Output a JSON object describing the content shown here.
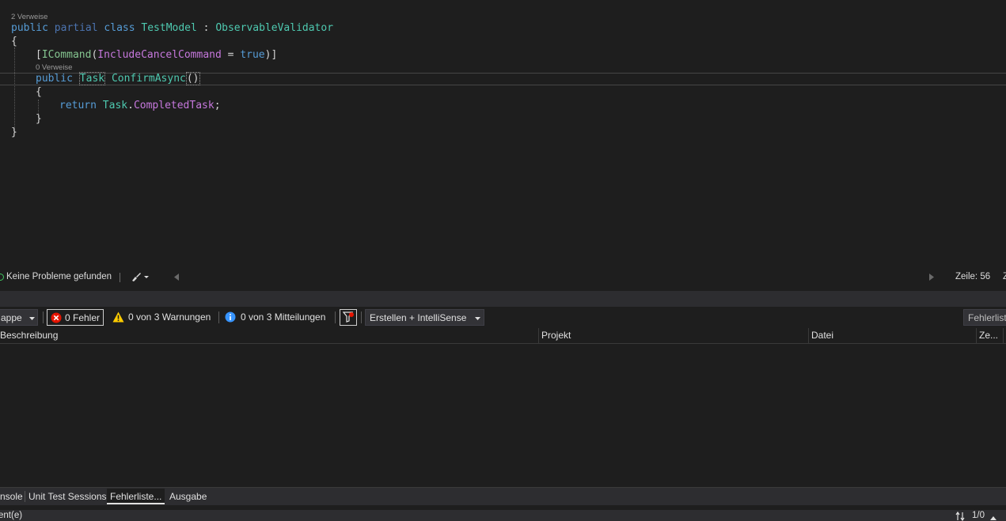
{
  "editor": {
    "lens_class": "2 Verweise",
    "lens_method": "0 Verweise",
    "code": {
      "kw_public": "public",
      "kw_partial": "partial",
      "kw_class": "class",
      "class_name": "TestModel",
      "colon": " : ",
      "base_class": "ObservableValidator",
      "open_brace": "{",
      "close_brace": "}",
      "attr_open": "[",
      "attr_name": "ICommand",
      "attr_paren_open": "(",
      "attr_prop": "IncludeCancelCommand",
      "attr_eq": " = ",
      "attr_true": "true",
      "attr_close": ")]",
      "method_public": "public",
      "method_return": "Task",
      "method_name": "ConfirmAsync",
      "method_parens": "()",
      "kw_return": "return",
      "task_ref": "Task",
      "dot": ".",
      "completed": "CompletedTask",
      "semicolon": ";"
    }
  },
  "editor_status": {
    "problems": "Keine Probleme gefunden",
    "line": "Zeile: 56",
    "col_partial": "Z"
  },
  "error_list": {
    "scope_partial": "appe",
    "errors": "0 Fehler",
    "warnings": "0 von 3 Warnungen",
    "messages": "0 von 3 Mitteilungen",
    "build_filter": "Erstellen + IntelliSense",
    "search_partial": "Fehlerlist",
    "columns": {
      "description": "Beschreibung",
      "project": "Projekt",
      "file": "Datei",
      "line": "Ze..."
    }
  },
  "tabs": [
    "nsole",
    "Unit Test Sessions",
    "Fehlerliste...",
    "Ausgabe"
  ],
  "statusbar": {
    "left_partial": "ent(e)",
    "right": "1/0"
  },
  "colors": {
    "keyword": "#569cd6",
    "type": "#4ec9b0",
    "property": "#c678dd",
    "error": "#e51400",
    "warning": "#ffcc00",
    "info": "#3794ff",
    "ok": "#3fc560"
  }
}
